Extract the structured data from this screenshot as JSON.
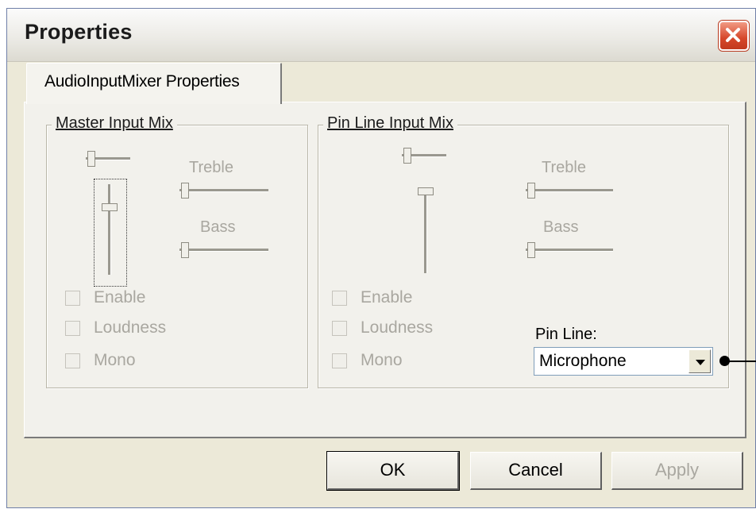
{
  "window": {
    "title": "Properties"
  },
  "tabs": [
    {
      "label": "AudioInputMixer Properties",
      "active": true
    }
  ],
  "master_group": {
    "legend": "Master Input Mix",
    "treble_label": "Treble",
    "bass_label": "Bass",
    "enable_label": "Enable",
    "loudness_label": "Loudness",
    "mono_label": "Mono"
  },
  "pin_group": {
    "legend": "Pin Line Input Mix",
    "treble_label": "Treble",
    "bass_label": "Bass",
    "enable_label": "Enable",
    "loudness_label": "Loudness",
    "mono_label": "Mono",
    "pin_line_label": "Pin Line:",
    "pin_line_value": "Microphone"
  },
  "buttons": {
    "ok": "OK",
    "cancel": "Cancel",
    "apply": "Apply"
  },
  "icons": {
    "close": "close-icon",
    "dropdown": "chevron-down-icon"
  },
  "colors": {
    "close_button": "#d6472a",
    "disabled_text": "#a9a7a0",
    "dialog_bg": "#ece9d8"
  }
}
